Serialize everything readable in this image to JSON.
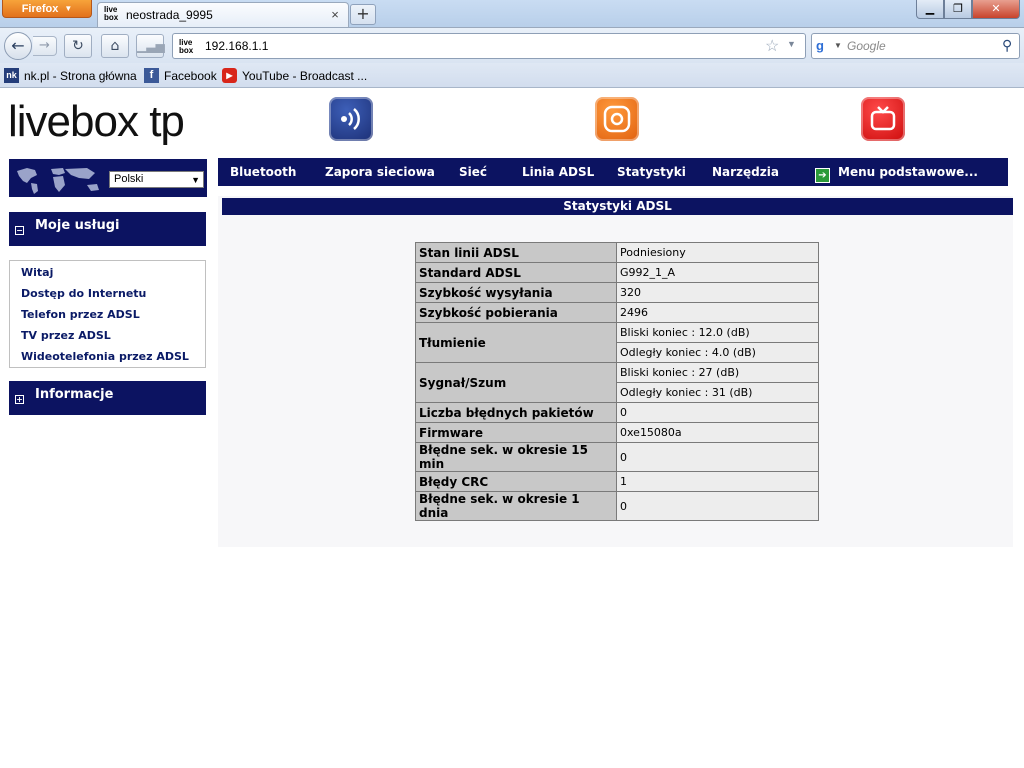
{
  "browser": {
    "menu_button": "Firefox",
    "tab": {
      "favicon_top": "live",
      "favicon_bottom": "box",
      "title": "neostrada_9995"
    },
    "url": "192.168.1.1",
    "search_placeholder": "Google",
    "bookmarks": [
      {
        "icon": "nk",
        "label": "nk.pl - Strona główna"
      },
      {
        "icon": "f",
        "label": "Facebook"
      },
      {
        "icon": "▶",
        "label": "YouTube - Broadcast ..."
      }
    ]
  },
  "page": {
    "logo": "livebox tp",
    "language": {
      "selected": "Polski"
    },
    "sidebar": {
      "services_header": "Moje usługi",
      "services": [
        "Witaj",
        "Dostęp do Internetu",
        "Telefon przez ADSL",
        "TV przez ADSL",
        "Wideotelefonia przez ADSL"
      ],
      "info_header": "Informacje"
    },
    "nav": {
      "items": [
        "Bluetooth",
        "Zapora sieciowa",
        "Sieć",
        "Linia ADSL",
        "Statystyki",
        "Narzędzia"
      ],
      "basic_menu": "Menu podstawowe..."
    },
    "panel_title": "Statystyki ADSL",
    "stats": {
      "line_state": {
        "label": "Stan linii ADSL",
        "value": "Podniesiony"
      },
      "standard": {
        "label": "Standard ADSL",
        "value": "G992_1_A"
      },
      "upload": {
        "label": "Szybkość wysyłania",
        "value": "320"
      },
      "download": {
        "label": "Szybkość pobierania",
        "value": "2496"
      },
      "attenuation": {
        "label": "Tłumienie",
        "near": "Bliski koniec : 12.0 (dB)",
        "far": "Odległy koniec : 4.0 (dB)"
      },
      "snr": {
        "label": "Sygnał/Szum",
        "near": "Bliski koniec : 27 (dB)",
        "far": "Odległy koniec : 31 (dB)"
      },
      "bad_packets": {
        "label": "Liczba błędnych pakietów",
        "value": "0"
      },
      "firmware": {
        "label": "Firmware",
        "value": "0xe15080a"
      },
      "err_15min": {
        "label": "Błędne sek. w okresie 15 min",
        "value": "0"
      },
      "crc": {
        "label": "Błędy CRC",
        "value": "1"
      },
      "err_1day": {
        "label": "Błędne sek. w okresie 1 dnia",
        "value": "0"
      }
    }
  }
}
